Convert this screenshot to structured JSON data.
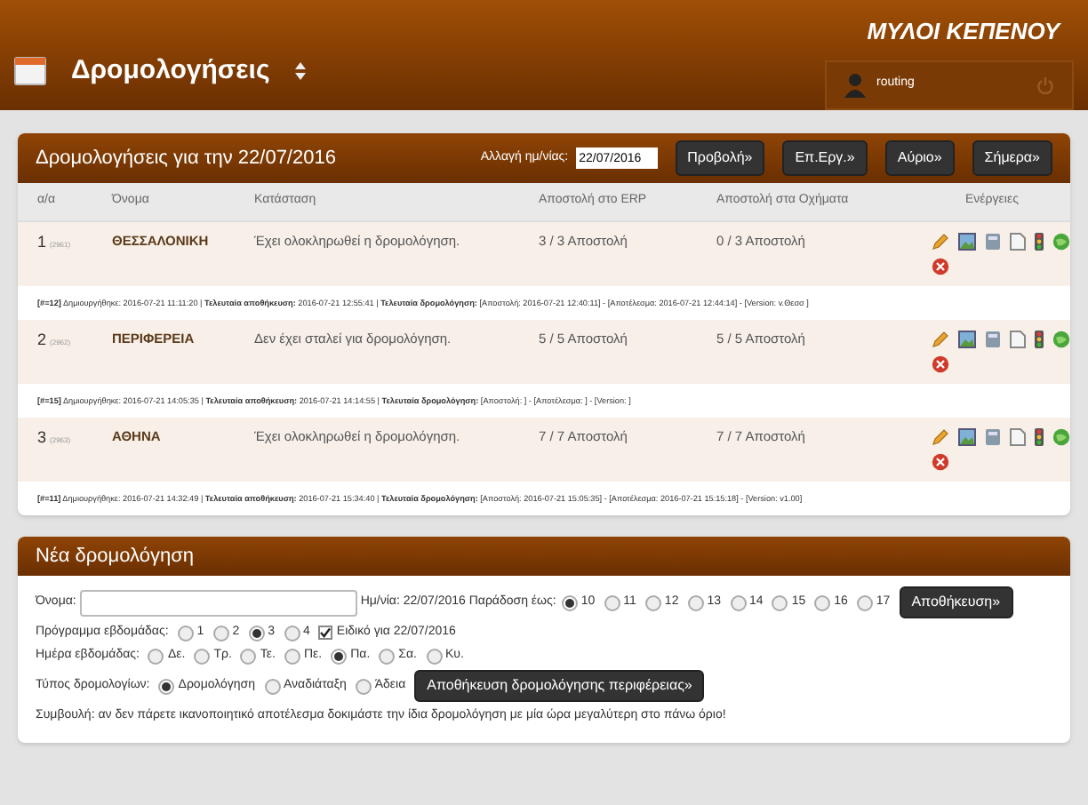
{
  "header": {
    "brand": "ΜΥΛΟΙ ΚΕΠΕΝΟΥ",
    "section_title": "Δρομολογήσεις",
    "user": "routing"
  },
  "routes_panel": {
    "title": "Δρομολογήσεις για την 22/07/2016",
    "date_label": "Αλλαγή ημ/νίας:",
    "date_value": "22/07/2016",
    "buttons": [
      "Προβολή»",
      "Επ.Εργ.»",
      "Αύριο»",
      "Σήμερα»"
    ]
  },
  "table": {
    "columns": [
      "α/α",
      "Όνομα",
      "Κατάσταση",
      "Αποστολή στο ERP",
      "Αποστολή στα Οχήματα",
      "Ενέργειες"
    ],
    "rows": [
      {
        "no": "1",
        "code": "(2961)",
        "name": "ΘΕΣΣΑΛΟΝΙΚΗ",
        "status": "Έχει ολοκληρωθεί η δρομολόγηση.",
        "erp": "3 / 3 Αποστολή",
        "vehicles": "0 / 3 Αποστολή",
        "info": "**[#=12]** Δημιουργήθηκε: 2016-07-21 11:11:20 | **Τελευταία αποθήκευση:** 2016-07-21 12:55:41 | **Τελευταία δρομολόγηση:** [Αποστολή: 2016-07-21 12:40:11] - [Αποτέλεσμα: 2016-07-21 12:44:14] - [Version: v.Θεσσ ]"
      },
      {
        "no": "2",
        "code": "(2962)",
        "name": "ΠΕΡΙΦΕΡΕΙΑ",
        "status": "Δεν έχει σταλεί για δρομολόγηση.",
        "erp": "5 / 5 Αποστολή",
        "vehicles": "5 / 5 Αποστολή",
        "info": "**[#=15]** Δημιουργήθηκε: 2016-07-21 14:05:35 | **Τελευταία αποθήκευση:** 2016-07-21 14:14:55 | **Τελευταία δρομολόγηση:** [Αποστολή: ] - [Αποτέλεσμα: ] - [Version: ]"
      },
      {
        "no": "3",
        "code": "(2963)",
        "name": "ΑΘΗΝΑ",
        "status": "Έχει ολοκληρωθεί η δρομολόγηση.",
        "erp": "7 / 7 Αποστολή",
        "vehicles": "7 / 7 Αποστολή",
        "info": "**[#=11]** Δημιουργήθηκε: 2016-07-21 14:32:49 | **Τελευταία αποθήκευση:** 2016-07-21 15:34:40 | **Τελευταία δρομολόγηση:** [Αποστολή: 2016-07-21 15:05:35] - [Αποτέλεσμα: 2016-07-21 15:15:18] - [Version: v1.00]"
      }
    ]
  },
  "new_route": {
    "title": "Νέα δρομολόγηση",
    "name_label": "Όνομα:",
    "date_text": "Ημ/νία: 22/07/2016 Παράδοση έως:",
    "hours": [
      {
        "label": "10",
        "selected": true
      },
      {
        "label": "11",
        "selected": false
      },
      {
        "label": "12",
        "selected": false
      },
      {
        "label": "13",
        "selected": false
      },
      {
        "label": "14",
        "selected": false
      },
      {
        "label": "15",
        "selected": false
      },
      {
        "label": "16",
        "selected": false
      },
      {
        "label": "17",
        "selected": false
      }
    ],
    "save_button": "Αποθήκευση»",
    "week_label": "Πρόγραμμα εβδομάδας:",
    "weeks": [
      {
        "label": "1",
        "selected": false
      },
      {
        "label": "2",
        "selected": false
      },
      {
        "label": "3",
        "selected": true
      },
      {
        "label": "4",
        "selected": false
      }
    ],
    "special": {
      "label": "Ειδικό για 22/07/2016",
      "checked": true
    },
    "day_label": "Ημέρα εβδομάδας:",
    "days": [
      {
        "label": "Δε.",
        "selected": false
      },
      {
        "label": "Τρ.",
        "selected": false
      },
      {
        "label": "Τε.",
        "selected": false
      },
      {
        "label": "Πε.",
        "selected": false
      },
      {
        "label": "Πα.",
        "selected": true
      },
      {
        "label": "Σα.",
        "selected": false
      },
      {
        "label": "Κυ.",
        "selected": false
      }
    ],
    "type_label": "Τύπος δρομολογίων:",
    "types": [
      {
        "label": "Δρομολόγηση",
        "selected": true
      },
      {
        "label": "Αναδιάταξη",
        "selected": false
      },
      {
        "label": "Άδεια",
        "selected": false
      }
    ],
    "region_button": "Αποθήκευση δρομολόγησης περιφέρειας»",
    "tip": "Συμβουλή: αν δεν πάρετε ικανοποιητικό αποτέλεσμα δοκιμάστε την ίδια δρομολόγηση με μία ώρα μεγαλύτερη στο πάνω όριο!"
  }
}
